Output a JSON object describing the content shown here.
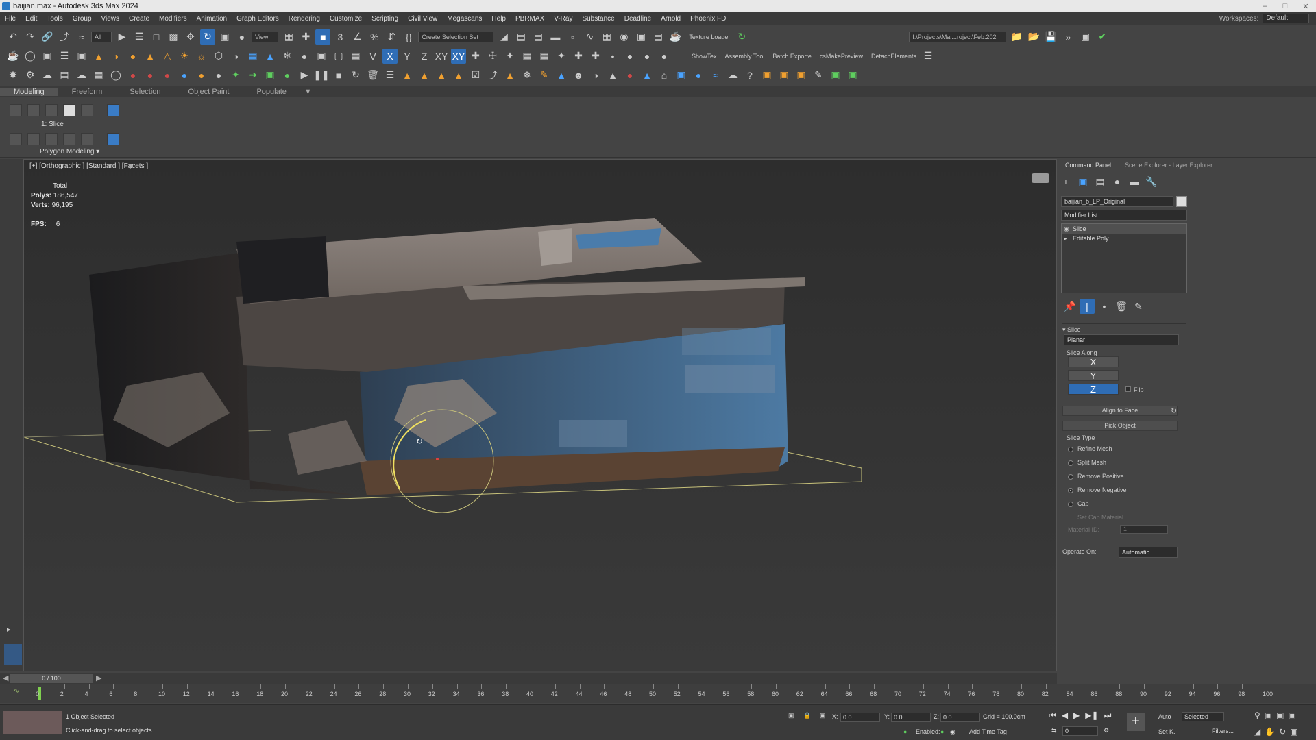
{
  "window": {
    "title": "baijian.max - Autodesk 3ds Max 2024"
  },
  "menu": {
    "items": [
      "File",
      "Edit",
      "Tools",
      "Group",
      "Views",
      "Create",
      "Modifiers",
      "Animation",
      "Graph Editors",
      "Rendering",
      "Customize",
      "Scripting",
      "Civil View",
      "Megascans",
      "Help",
      "PBRMAX",
      "V-Ray",
      "Substance",
      "Deadline",
      "Arnold",
      "Phoenix FD"
    ],
    "workspaces_label": "Workspaces:",
    "workspaces_value": "Default"
  },
  "toolbar": {
    "selection_filter": "All",
    "ref_coord": "View",
    "named_selection": "Create Selection Set",
    "texture_loader": "Texture Loader",
    "project_path": "I:\\Projects\\Mai...roject\\Feb.202",
    "axis_x": "X",
    "axis_y": "Y",
    "axis_z": "Z",
    "axis_xy": "XY",
    "axis_xy2": "XY",
    "show_tex": "ShowTex",
    "assembly_tool": "Assembly Tool",
    "batch_export": "Batch Exporte",
    "cs_make_preview": "csMakePreview",
    "detach_elements": "DetachElements"
  },
  "ribbon": {
    "tabs": [
      "Modeling",
      "Freeform",
      "Selection",
      "Object Paint",
      "Populate"
    ],
    "active_tab": "Modeling",
    "stack_label": "1: Slice",
    "group_label": "Polygon Modeling"
  },
  "viewport": {
    "label": "[+] [Orthographic ] [Standard ] [Facets ]",
    "stats_title": "Total",
    "polys_label": "Polys:",
    "polys_value": "186,547",
    "verts_label": "Verts:",
    "verts_value": "96,195",
    "fps_label": "FPS:",
    "fps_value": "6"
  },
  "command_panel": {
    "tabs": [
      "Command Panel",
      "Scene Explorer - Layer Explorer"
    ],
    "object_name": "baijian_b_LP_Original",
    "modifier_list": "Modifier List",
    "stack": [
      "Slice",
      "Editable Poly"
    ],
    "rollout_title": "Slice",
    "slice_mode": "Planar",
    "slice_along_label": "Slice Along",
    "axes": [
      "X",
      "Y",
      "Z"
    ],
    "active_axis": "Z",
    "flip_label": "Flip",
    "align_to_face": "Align to Face",
    "pick_object": "Pick Object",
    "slice_type_label": "Slice Type",
    "slice_types": [
      "Refine Mesh",
      "Split Mesh",
      "Remove Positive",
      "Remove Negative",
      "Cap"
    ],
    "selected_slice_type": "Remove Negative",
    "set_cap_material": "Set Cap Material",
    "material_id_label": "Material ID:",
    "material_id_value": "1",
    "operate_on_label": "Operate On:",
    "operate_on_value": "Automatic"
  },
  "timeline": {
    "frame_indicator": "0 / 100",
    "ticks": [
      "0",
      "2",
      "4",
      "6",
      "8",
      "10",
      "12",
      "14",
      "16",
      "18",
      "20",
      "22",
      "24",
      "26",
      "28",
      "30",
      "32",
      "34",
      "36",
      "38",
      "40",
      "42",
      "44",
      "46",
      "48",
      "50",
      "52",
      "54",
      "56",
      "58",
      "60",
      "62",
      "64",
      "66",
      "68",
      "70",
      "72",
      "74",
      "76",
      "78",
      "80",
      "82",
      "84",
      "86",
      "88",
      "90",
      "92",
      "94",
      "96",
      "98",
      "100"
    ]
  },
  "status": {
    "selection": "1 Object Selected",
    "prompt": "Click-and-drag to select objects",
    "x_label": "X:",
    "x_value": "0.0",
    "y_label": "Y:",
    "y_value": "0.0",
    "z_label": "Z:",
    "z_value": "0.0",
    "grid": "Grid = 100.0cm",
    "enabled_label": "Enabled:",
    "add_time_tag": "Add Time Tag",
    "auto_label": "Auto",
    "set_key_label": "Set K.",
    "key_mode": "Selected",
    "filters_label": "Filters...",
    "frame_value": "0"
  },
  "colors": {
    "accent": "#2f6db5",
    "viewport_bg": "#333333",
    "grid_line": "#c8c27a"
  }
}
